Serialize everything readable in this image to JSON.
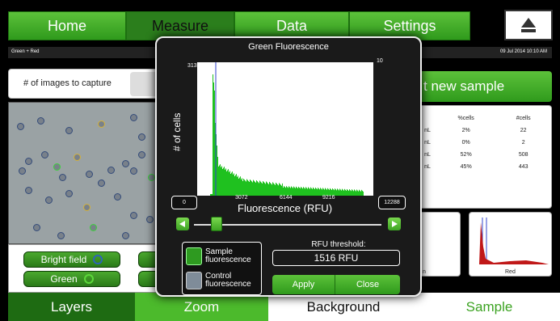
{
  "nav": {
    "tabs": [
      {
        "label": "Home"
      },
      {
        "label": "Measure"
      },
      {
        "label": "Data"
      },
      {
        "label": "Settings"
      }
    ],
    "active_tab": "Measure"
  },
  "subbar": {
    "left": "Green + Red",
    "right": "09 Jul 2014 10:10 AM"
  },
  "capture": {
    "label": "# of images to capture"
  },
  "new_sample": {
    "label": "t new sample"
  },
  "stats": {
    "headers": [
      "%cells",
      "#cells"
    ],
    "rows": [
      {
        "unit": "nL",
        "pct": "2%",
        "count": "22"
      },
      {
        "unit": "nL",
        "pct": "0%",
        "count": "2"
      },
      {
        "unit": "nL",
        "pct": "52%",
        "count": "508"
      },
      {
        "unit": "nL",
        "pct": "45%",
        "count": "443"
      }
    ]
  },
  "mini_hist": {
    "left_label": "n",
    "right_label": "Red"
  },
  "layers": {
    "bright_field": "Bright field",
    "green": "Green"
  },
  "bottom": {
    "layers": "Layers",
    "zoom": "Zoom",
    "background": "Background",
    "sample": "Sample"
  },
  "modal": {
    "title": "Green Fluorescence",
    "y_max": "313",
    "y2_max": "10",
    "ylabel": "# of cells",
    "x_min": "0",
    "x_max": "12288",
    "x_ticks": [
      "3072",
      "6144",
      "9216"
    ],
    "xlabel": "Fluorescence (RFU)",
    "slider_value": 0.12,
    "legend": {
      "sample": "Sample fluorescence",
      "control": "Control fluorescence"
    },
    "threshold_label": "RFU threshold:",
    "threshold_value": "1516 RFU",
    "apply": "Apply",
    "close": "Close"
  },
  "colors": {
    "accent": "#3ca322",
    "sample": "#2e9a20",
    "control": "#7f8c99",
    "threshold_line": "#3344cc"
  }
}
